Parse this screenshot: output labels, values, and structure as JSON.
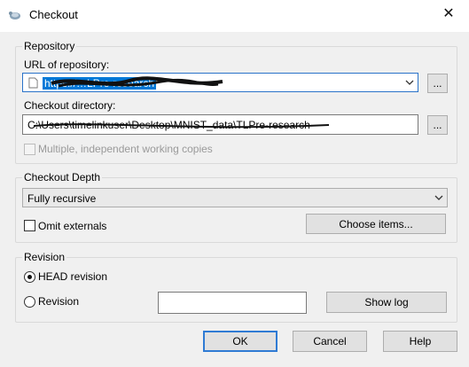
{
  "window": {
    "title": "Checkout",
    "close_glyph": "✕"
  },
  "repository": {
    "group_label": "Repository",
    "url_label": "URL of repository:",
    "url_value": "https://…LPre-research",
    "browse_label": "...",
    "dir_label": "Checkout directory:",
    "dir_value": "C:\\Users\\timelinkuser\\Desktop\\MNIST_data\\TLPre-research",
    "dir_browse_label": "...",
    "multiple_copies_label": "Multiple, independent working copies"
  },
  "depth": {
    "group_label": "Checkout Depth",
    "selected": "Fully recursive",
    "omit_externals_label": "Omit externals",
    "choose_items_label": "Choose items..."
  },
  "revision": {
    "group_label": "Revision",
    "head_label": "HEAD revision",
    "revision_label": "Revision",
    "revision_value": "",
    "show_log_label": "Show log"
  },
  "buttons": {
    "ok": "OK",
    "cancel": "Cancel",
    "help": "Help"
  },
  "colors": {
    "selection": "#0078d7",
    "accent_border": "#2f7bd4"
  },
  "icons": {
    "app": "tortoise-icon",
    "dropdown": "chevron-down-icon",
    "file": "file-icon"
  }
}
